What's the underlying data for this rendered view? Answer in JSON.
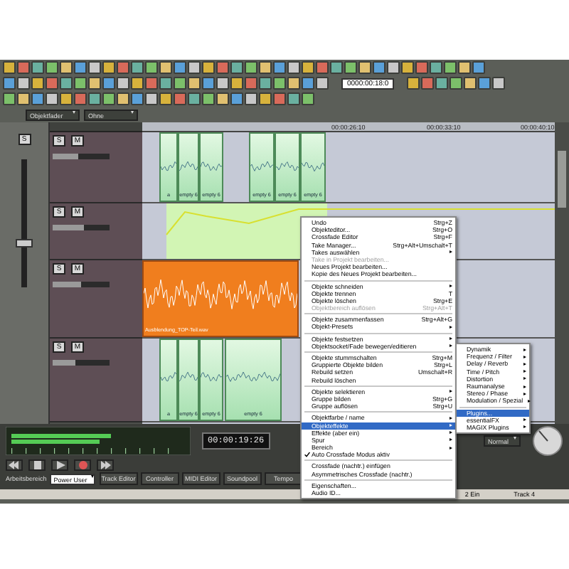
{
  "toolbar": {
    "object_mode": "Objektfader",
    "snap_mode": "Ohne",
    "counter": "0000:00:18:0"
  },
  "mixer": {
    "solo": "S",
    "level": 0.35
  },
  "ruler": [
    "00:00:26:10",
    "00:00:33:10",
    "00:00:40:10"
  ],
  "tracks": [
    {
      "kind": "clips",
      "color": "#a6e0b0",
      "buttons": [
        "S",
        "M"
      ],
      "level": 0.45,
      "clips": [
        {
          "label": "a"
        },
        {
          "label": "empty 6"
        },
        {
          "label": "empty 6"
        },
        {
          "label": "empty 6"
        },
        {
          "label": "empty 6"
        },
        {
          "label": "empty 6"
        }
      ]
    },
    {
      "kind": "automation",
      "color": "#d2f5b4",
      "buttons": [
        "S",
        "M"
      ],
      "level": 0.55
    },
    {
      "kind": "audio",
      "color": "#f07e1e",
      "buttons": [
        "S",
        "M"
      ],
      "level": 0.5,
      "label": "Ausblendung_TOP-Teil.wav"
    },
    {
      "kind": "clips",
      "color": "#a6e0b0",
      "buttons": [
        "S",
        "M"
      ],
      "level": 0.4,
      "clips": [
        {
          "label": "a"
        },
        {
          "label": "empty 6"
        },
        {
          "label": "empty 6"
        },
        {
          "label": "empty 6"
        }
      ]
    }
  ],
  "context_menu": [
    {
      "label": "Undo",
      "shortcut": "Strg+Z",
      "submenu": false,
      "disabled": false,
      "checked": false,
      "selected": false
    },
    {
      "label": "Objekteditor...",
      "shortcut": "Strg+O",
      "submenu": false,
      "disabled": false,
      "checked": false,
      "selected": false
    },
    {
      "label": "Crossfade Editor",
      "shortcut": "Strg+F",
      "submenu": false,
      "disabled": false,
      "checked": false,
      "selected": false
    },
    {
      "label": "Take Manager...",
      "shortcut": "Strg+Alt+Umschalt+T",
      "submenu": false,
      "disabled": false,
      "checked": false,
      "selected": false
    },
    {
      "label": "Takes auswählen",
      "submenu": true,
      "disabled": false,
      "checked": false,
      "selected": false
    },
    {
      "label": "Take in Projekt bearbeiten...",
      "submenu": false,
      "disabled": true,
      "checked": false,
      "selected": false
    },
    {
      "label": "Neues Projekt bearbeiten...",
      "submenu": false,
      "disabled": false,
      "checked": false,
      "selected": false
    },
    {
      "label": "Kopie des Neues Projekt bearbeiten...",
      "submenu": false,
      "disabled": false,
      "checked": false,
      "selected": false
    },
    {
      "kind": "separator"
    },
    {
      "label": "Objekte schneiden",
      "submenu": true,
      "disabled": false,
      "checked": false,
      "selected": false
    },
    {
      "label": "Objekte trennen",
      "shortcut": "T",
      "submenu": false,
      "disabled": false,
      "checked": false,
      "selected": false
    },
    {
      "label": "Objekte löschen",
      "shortcut": "Strg+E",
      "submenu": false,
      "disabled": false,
      "checked": false,
      "selected": false
    },
    {
      "label": "Objektbereich auflösen",
      "shortcut": "Strg+Alt+T",
      "submenu": false,
      "disabled": true,
      "checked": false,
      "selected": false
    },
    {
      "kind": "separator"
    },
    {
      "label": "Objekte zusammenfassen",
      "shortcut": "Strg+Alt+G",
      "submenu": false,
      "disabled": false,
      "checked": false,
      "selected": false
    },
    {
      "label": "Objekt-Presets",
      "submenu": true,
      "disabled": false,
      "checked": false,
      "selected": false
    },
    {
      "kind": "separator"
    },
    {
      "label": "Objekte festsetzen",
      "submenu": true,
      "disabled": false,
      "checked": false,
      "selected": false
    },
    {
      "label": "Objektsocket/Fade bewegen/editieren",
      "submenu": true,
      "disabled": false,
      "checked": false,
      "selected": false
    },
    {
      "kind": "separator"
    },
    {
      "label": "Objekte stummschalten",
      "shortcut": "Strg+M",
      "submenu": false,
      "disabled": false,
      "checked": false,
      "selected": false
    },
    {
      "label": "Gruppierte Objekte bilden",
      "shortcut": "Strg+L",
      "submenu": false,
      "disabled": false,
      "checked": false,
      "selected": false
    },
    {
      "label": "Rebuild setzen",
      "shortcut": "Umschalt+R",
      "submenu": false,
      "disabled": false,
      "checked": false,
      "selected": false
    },
    {
      "label": "Rebuild löschen",
      "submenu": false,
      "disabled": false,
      "checked": false,
      "selected": false
    },
    {
      "kind": "separator"
    },
    {
      "label": "Objekte selektieren",
      "submenu": true,
      "disabled": false,
      "checked": false,
      "selected": false
    },
    {
      "label": "Gruppe bilden",
      "shortcut": "Strg+G",
      "submenu": false,
      "disabled": false,
      "checked": false,
      "selected": false
    },
    {
      "label": "Gruppe auflösen",
      "shortcut": "Strg+U",
      "submenu": false,
      "disabled": false,
      "checked": false,
      "selected": false
    },
    {
      "kind": "separator"
    },
    {
      "label": "Objektfarbe / name",
      "submenu": true,
      "disabled": false,
      "checked": false,
      "selected": false
    },
    {
      "label": "Objekteffekte",
      "submenu": true,
      "disabled": false,
      "checked": false,
      "selected": true
    },
    {
      "label": "Effekte (aber ein)",
      "submenu": true,
      "disabled": false,
      "checked": false,
      "selected": false
    },
    {
      "label": "Spur",
      "submenu": true,
      "disabled": false,
      "checked": false,
      "selected": false
    },
    {
      "label": "Bereich",
      "submenu": true,
      "disabled": false,
      "checked": false,
      "selected": false
    },
    {
      "label": "Auto Crossfade Modus aktiv",
      "submenu": false,
      "disabled": false,
      "checked": true,
      "selected": false
    },
    {
      "kind": "separator"
    },
    {
      "label": "Crossfade (nachtr.) einfügen",
      "submenu": false,
      "disabled": false,
      "checked": false,
      "selected": false
    },
    {
      "label": "Asymmetrisches Crossfade (nachtr.)",
      "submenu": false,
      "disabled": false,
      "checked": false,
      "selected": false
    },
    {
      "kind": "separator"
    },
    {
      "label": "Eigenschaften...",
      "submenu": false,
      "disabled": false,
      "checked": false,
      "selected": false
    },
    {
      "label": "Audio ID...",
      "submenu": false,
      "disabled": false,
      "checked": false,
      "selected": false
    }
  ],
  "effects_submenu": [
    {
      "label": "Dynamik",
      "submenu": true,
      "selected": false
    },
    {
      "label": "Frequenz / Filter",
      "submenu": true,
      "selected": false
    },
    {
      "label": "Delay / Reverb",
      "submenu": true,
      "selected": false
    },
    {
      "label": "Time / Pitch",
      "submenu": true,
      "selected": false
    },
    {
      "label": "Distortion",
      "submenu": true,
      "selected": false
    },
    {
      "label": "Raumanalyse",
      "submenu": true,
      "selected": false
    },
    {
      "label": "Stereo / Phase",
      "submenu": true,
      "selected": false
    },
    {
      "label": "Modulation / Spezial",
      "submenu": true,
      "selected": false
    },
    {
      "kind": "separator"
    },
    {
      "label": "Plugins...",
      "submenu": false,
      "selected": true
    },
    {
      "label": "essentialFX",
      "submenu": true,
      "selected": false
    },
    {
      "label": "MAGIX Plugins",
      "submenu": true,
      "selected": false
    }
  ],
  "transport": {
    "time": "00:00:19:26",
    "mode": "Normal"
  },
  "workspace": {
    "label": "Arbeitsbereich",
    "value": "Power User"
  },
  "tabs": [
    {
      "label": "Track Editor",
      "selected": false
    },
    {
      "label": "Controller",
      "selected": false
    },
    {
      "label": "MIDI Editor",
      "selected": false
    },
    {
      "label": "Soundpool",
      "selected": false
    },
    {
      "label": "Tempo",
      "selected": false
    }
  ],
  "status_bar": [
    "2 Ein",
    "Track 4"
  ]
}
